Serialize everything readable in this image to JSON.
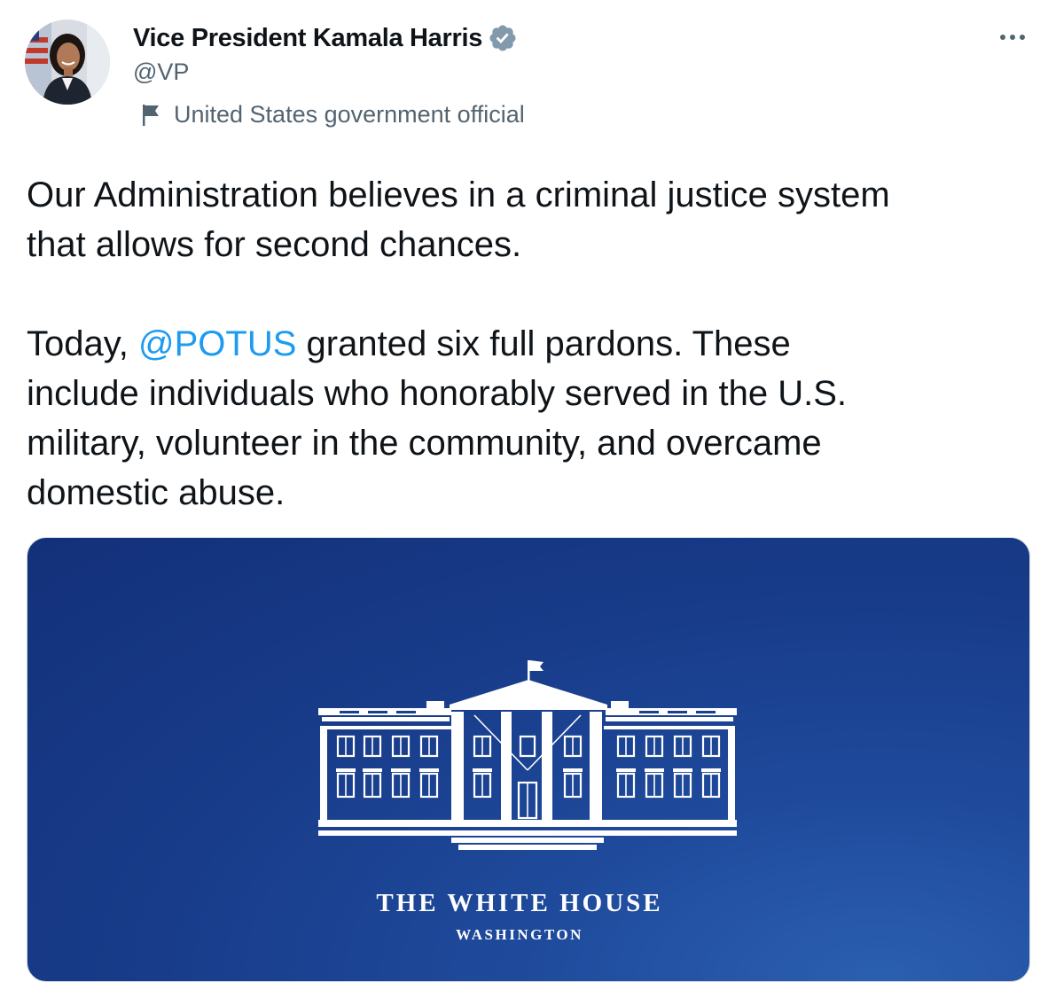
{
  "author": {
    "display_name": "Vice President Kamala Harris",
    "handle": "@VP",
    "label": "United States government official",
    "avatar_icon": "profile-photo",
    "verified_icon": "verified-badge-icon"
  },
  "tweet": {
    "paragraph1_line1": "Our Administration believes in a criminal justice system",
    "paragraph1_line2": "that allows for second chances.",
    "paragraph2_prefix": "Today, ",
    "mention": "@POTUS",
    "paragraph2_suffix": " granted six full pardons. These",
    "paragraph2_line2": "include individuals who honorably served in the U.S.",
    "paragraph2_line3": "military, volunteer in the community, and overcame",
    "paragraph2_line4": "domestic abuse."
  },
  "media": {
    "title": "THE WHITE HOUSE",
    "subtitle": "WASHINGTON"
  },
  "colors": {
    "link": "#1d9bf0",
    "secondary_text": "#536471",
    "primary_text": "#0f1419",
    "media_background": "#183c8a"
  }
}
